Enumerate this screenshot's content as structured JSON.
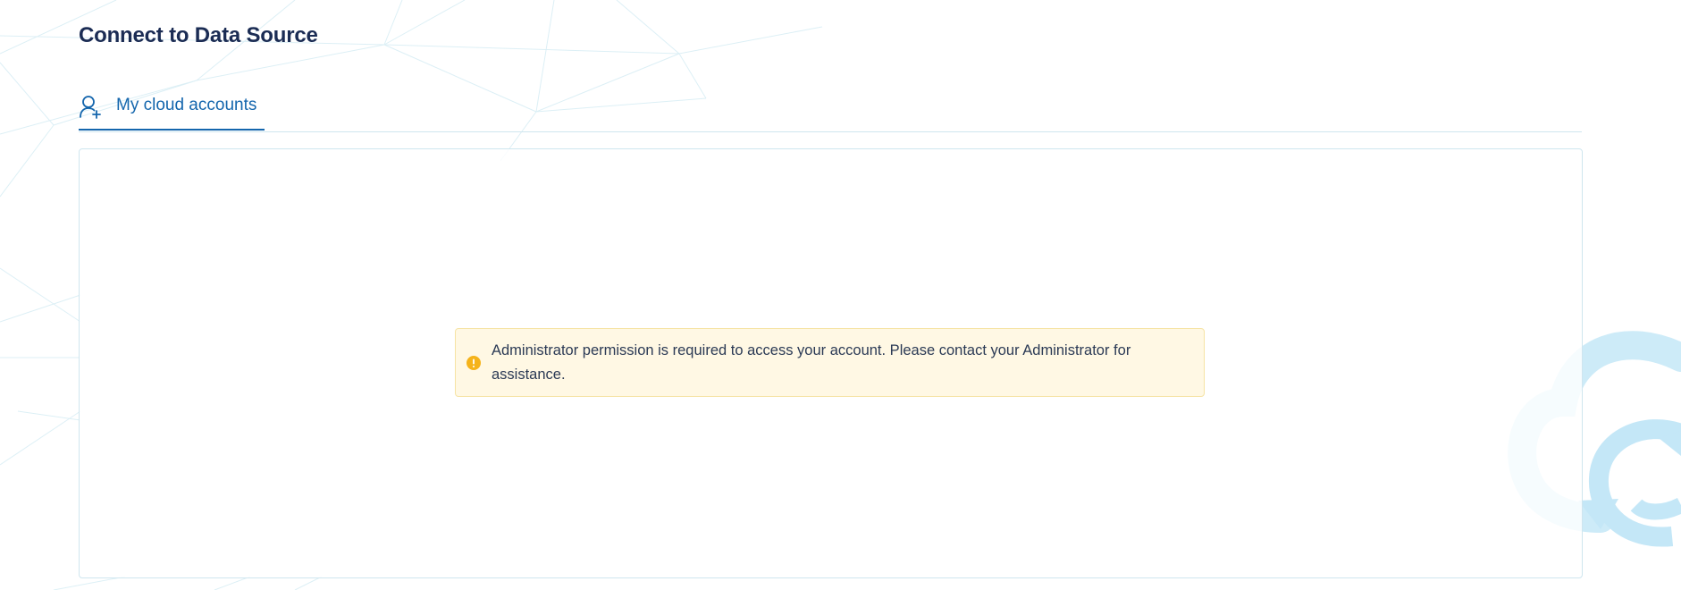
{
  "page": {
    "title": "Connect to Data Source"
  },
  "tabs": [
    {
      "label": "My cloud accounts",
      "icon": "user-plus-icon",
      "active": true
    }
  ],
  "alert": {
    "type": "warning",
    "icon": "warning-icon",
    "message": "Administrator permission is required to access your account. Please contact your Administrator for assistance."
  },
  "colors": {
    "title": "#1b2c54",
    "accent": "#1466ad",
    "alert_background": "#fff8e4",
    "alert_border": "#f6e3a4",
    "warning": "#f5b31a",
    "decoration": "#cdebf8"
  }
}
